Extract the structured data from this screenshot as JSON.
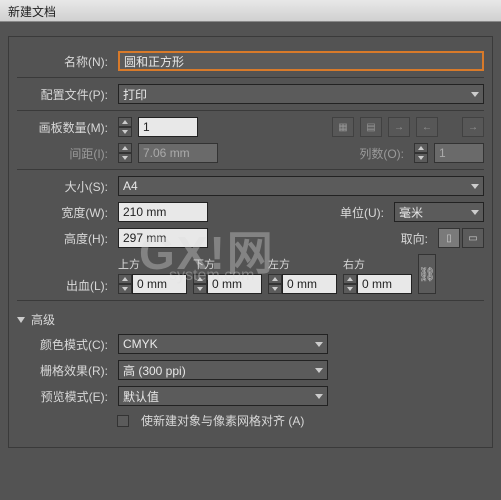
{
  "window": {
    "title": "新建文档"
  },
  "name": {
    "label": "名称(N):",
    "value": "圆和正方形"
  },
  "profile": {
    "label": "配置文件(P):",
    "value": "打印"
  },
  "artboards": {
    "label": "画板数量(M):",
    "value": "1"
  },
  "spacing": {
    "label": "间距(I):",
    "value": "7.06 mm"
  },
  "columns": {
    "label": "列数(O):",
    "value": "1"
  },
  "size": {
    "label": "大小(S):",
    "value": "A4"
  },
  "width": {
    "label": "宽度(W):",
    "value": "210 mm"
  },
  "height": {
    "label": "高度(H):",
    "value": "297 mm"
  },
  "unit": {
    "label": "单位(U):",
    "value": "毫米"
  },
  "orientation": {
    "label": "取向:"
  },
  "bleed": {
    "label": "出血(L):",
    "top": {
      "label": "上方",
      "value": "0 mm"
    },
    "bottom": {
      "label": "下方",
      "value": "0 mm"
    },
    "left": {
      "label": "左方",
      "value": "0 mm"
    },
    "right": {
      "label": "右方",
      "value": "0 mm"
    }
  },
  "advanced": {
    "label": "高级"
  },
  "colorMode": {
    "label": "颜色模式(C):",
    "value": "CMYK"
  },
  "raster": {
    "label": "栅格效果(R):",
    "value": "高 (300 ppi)"
  },
  "preview": {
    "label": "预览模式(E):",
    "value": "默认值"
  },
  "align": {
    "label": "使新建对象与像素网格对齐 (A)"
  },
  "watermark": {
    "big": "GX!网",
    "small": "system.com"
  }
}
